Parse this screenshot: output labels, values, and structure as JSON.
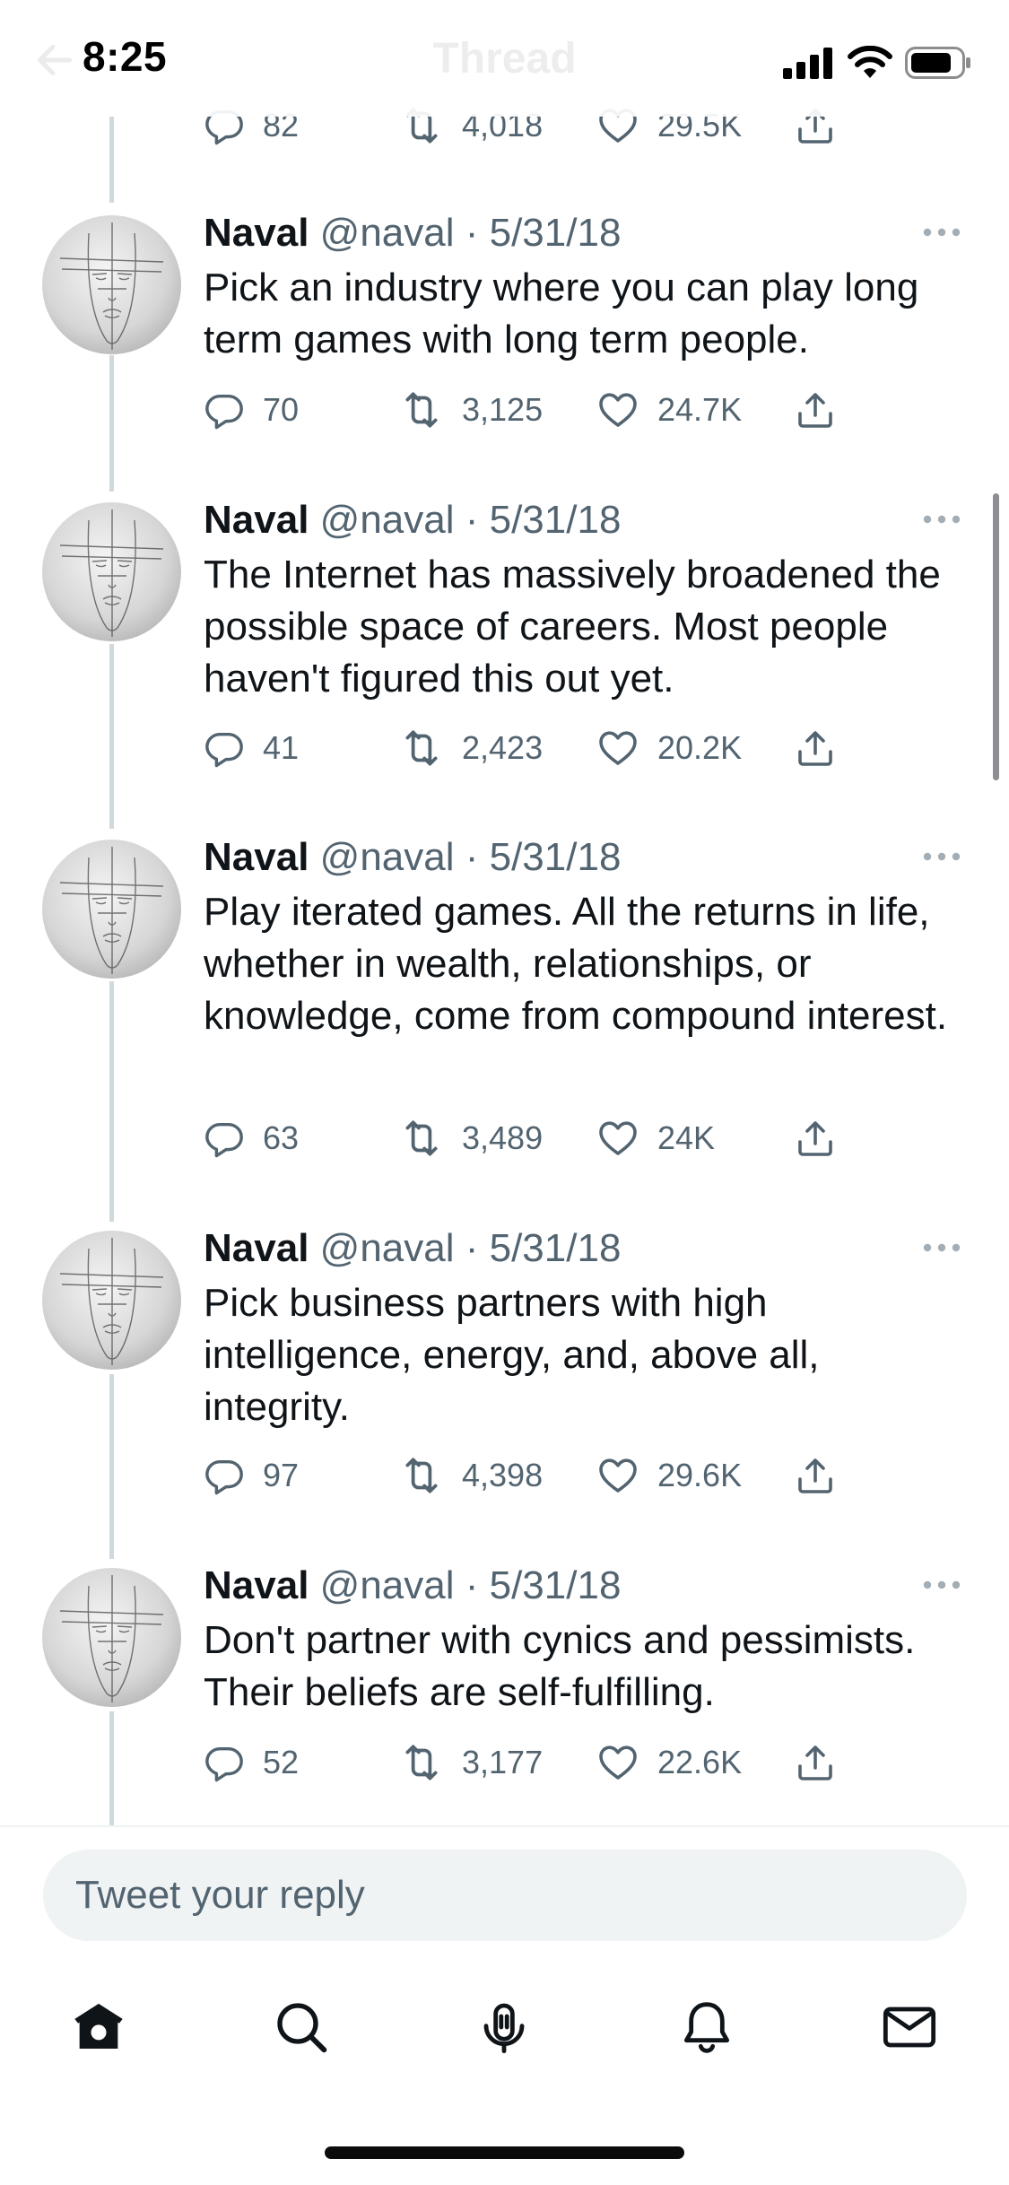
{
  "status_bar": {
    "time": "8:25"
  },
  "header": {
    "title": "Thread"
  },
  "partial_tweet": {
    "replies": "82",
    "retweets": "4,018",
    "likes": "29.5K"
  },
  "tweets": [
    {
      "name": "Naval",
      "meta": "@naval · 5/31/18",
      "text": "Pick an industry where you can play long term games with long term people.",
      "replies": "70",
      "retweets": "3,125",
      "likes": "24.7K"
    },
    {
      "name": "Naval",
      "meta": "@naval · 5/31/18",
      "text": "The Internet has massively broadened the possible space of careers. Most people haven't figured this out yet.",
      "replies": "41",
      "retweets": "2,423",
      "likes": "20.2K"
    },
    {
      "name": "Naval",
      "meta": "@naval · 5/31/18",
      "text": "Play iterated games. All the returns in life, whether in wealth, relationships, or knowledge, come from compound interest.",
      "replies": "63",
      "retweets": "3,489",
      "likes": "24K"
    },
    {
      "name": "Naval",
      "meta": "@naval · 5/31/18",
      "text": "Pick business partners with high intelligence, energy, and, above all, integrity.",
      "replies": "97",
      "retweets": "4,398",
      "likes": "29.6K"
    },
    {
      "name": "Naval",
      "meta": "@naval · 5/31/18",
      "text": "Don't partner with cynics and pessimists. Their beliefs are self-fulfilling.",
      "replies": "52",
      "retweets": "3,177",
      "likes": "22.6K"
    }
  ],
  "reply_box": {
    "placeholder": "Tweet your reply"
  },
  "tabbar": {
    "icons": [
      "home-icon",
      "search-icon",
      "spaces-icon",
      "notifications-icon",
      "messages-icon"
    ]
  },
  "colors": {
    "text": "#0f1419",
    "secondary": "#536471",
    "thread_line": "#cfd9de",
    "reply_background": "#eff3f4"
  }
}
